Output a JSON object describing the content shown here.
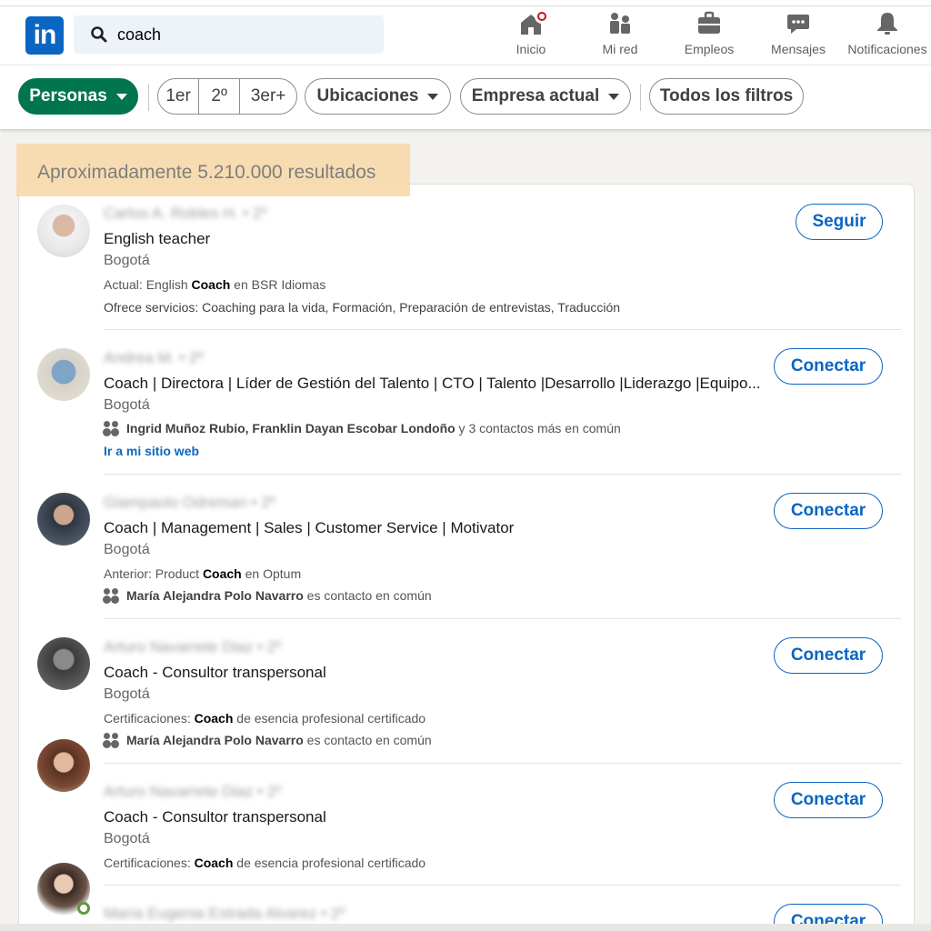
{
  "nav": {
    "logo": "in",
    "search_value": "coach",
    "items": [
      {
        "label": "Inicio",
        "icon": "home-icon"
      },
      {
        "label": "Mi red",
        "icon": "network-icon"
      },
      {
        "label": "Empleos",
        "icon": "briefcase-icon"
      },
      {
        "label": "Mensajes",
        "icon": "messaging-icon"
      },
      {
        "label": "Notificaciones",
        "icon": "bell-icon"
      }
    ]
  },
  "filters": {
    "personas": "Personas",
    "degrees": [
      "1er",
      "2º",
      "3er+"
    ],
    "ubicaciones": "Ubicaciones",
    "empresa": "Empresa actual",
    "todos": "Todos los filtros"
  },
  "results": {
    "count_text": "Aproximadamente 5.210.000 resultados",
    "people": [
      {
        "name": "Carlos A. Robles H. • 2º",
        "headline": "English teacher",
        "location": "Bogotá",
        "meta_prefix": "Actual: English ",
        "meta_bold": "Coach",
        "meta_suffix": " en BSR Idiomas",
        "services": "Ofrece servicios: Coaching para la vida, Formación, Preparación de entrevistas, Traducción",
        "action": "Seguir"
      },
      {
        "name": "Andrea M. • 2º",
        "headline": "Coach | Directora | Líder de Gestión del Talento | CTO | Talento |Desarrollo |Liderazgo |Equipo...",
        "location": "Bogotá",
        "mutual_bold": "Ingrid Muñoz Rubio, Franklin Dayan Escobar Londoño",
        "mutual_suffix": " y 3 contactos más en común",
        "link": "Ir a mi sitio web",
        "action": "Conectar"
      },
      {
        "name": "Giampaolo Odreman • 2º",
        "headline": "Coach | Management | Sales | Customer Service | Motivator",
        "location": "Bogotá",
        "meta_prefix": "Anterior: Product ",
        "meta_bold": "Coach",
        "meta_suffix": " en Optum",
        "mutual_bold": "María Alejandra Polo Navarro",
        "mutual_suffix": " es contacto en común",
        "action": "Conectar"
      },
      {
        "name": "Arturo Navarrete Diaz • 2º",
        "headline": "Coach - Consultor transpersonal",
        "location": "Bogotá",
        "meta_prefix": "Certificaciones: ",
        "meta_bold": "Coach",
        "meta_suffix": " de esencia profesional certificado",
        "mutual_bold": "María Alejandra Polo Navarro",
        "mutual_suffix": " es contacto en común",
        "action": "Conectar"
      },
      {
        "name": "Arturo Navarrete Diaz • 2º",
        "headline": "Coach - Consultor transpersonal",
        "location": "Bogotá",
        "meta_prefix": "Certificaciones: ",
        "meta_bold": "Coach",
        "meta_suffix": " de esencia profesional certificado",
        "action": "Conectar"
      },
      {
        "name": "María Eugenia Estrada Alvarez • 2º",
        "action": "Conectar"
      }
    ]
  },
  "colors": {
    "brand": "#0a66c2",
    "personas_active": "#01754f",
    "highlight": "#f8d9a8"
  }
}
